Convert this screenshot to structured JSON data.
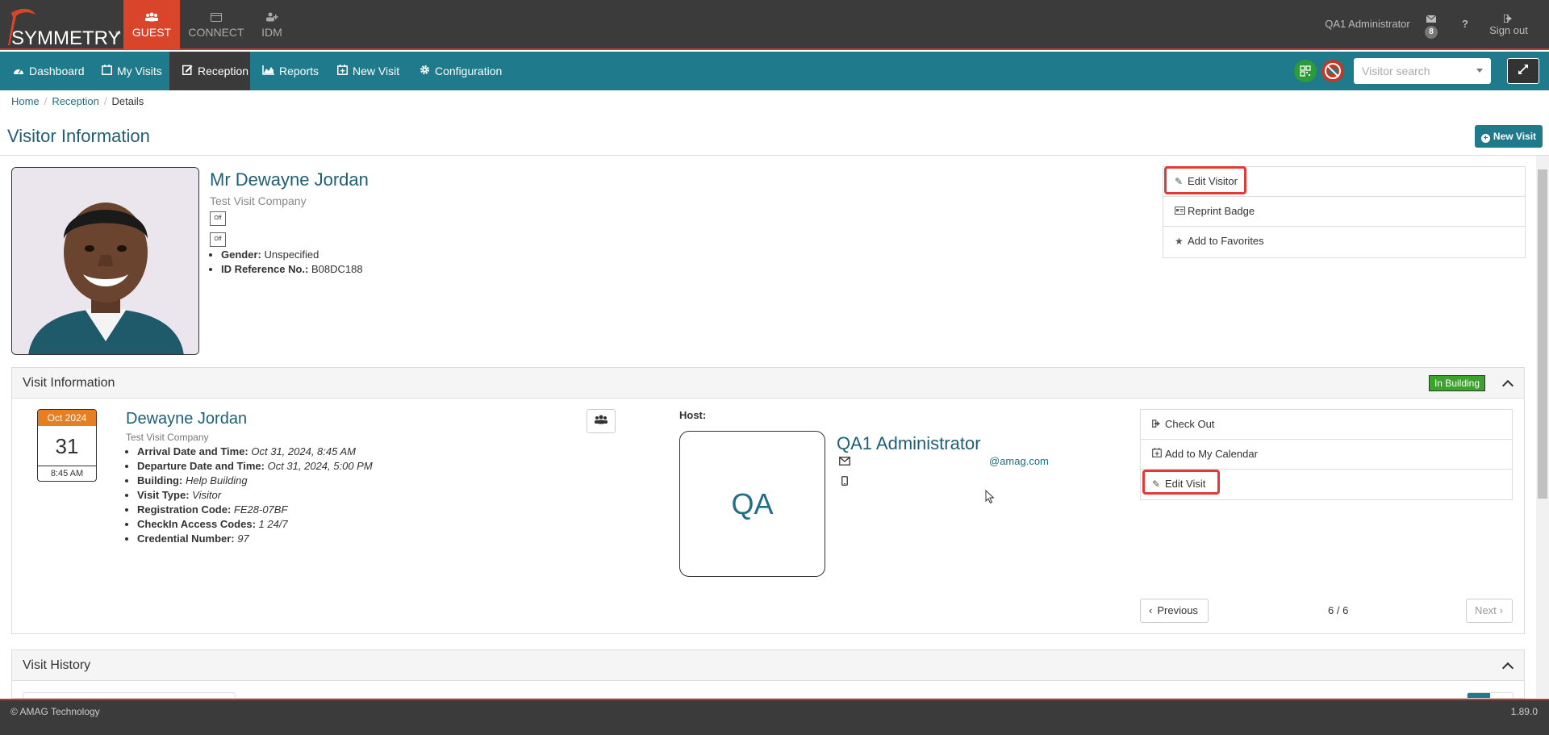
{
  "brand": {
    "logo_text": "SYMMETRY",
    "logo_tm": "™"
  },
  "modules": [
    {
      "label": "GUEST",
      "icon": "users-icon"
    },
    {
      "label": "CONNECT",
      "icon": "card-icon"
    },
    {
      "label": "IDM",
      "icon": "user-plus-icon"
    }
  ],
  "top_right": {
    "user": "QA1 Administrator",
    "mail_count": "8",
    "help": "?",
    "signout": "Sign out"
  },
  "nav": [
    {
      "label": "Dashboard",
      "icon": "dashboard-icon"
    },
    {
      "label": "My Visits",
      "icon": "calendar-icon"
    },
    {
      "label": "Reception",
      "icon": "edit-icon"
    },
    {
      "label": "Reports",
      "icon": "area-chart-icon"
    },
    {
      "label": "New Visit",
      "icon": "calendar-plus-icon"
    },
    {
      "label": "Configuration",
      "icon": "gear-icon"
    }
  ],
  "search": {
    "placeholder": "Visitor search"
  },
  "breadcrumb": [
    "Home",
    "Reception",
    "Details"
  ],
  "page": {
    "title": "Visitor Information",
    "new_visit_label": "New Visit"
  },
  "visitor": {
    "name": "Mr Dewayne Jordan",
    "company": "Test Visit Company",
    "toggle1": "Off",
    "toggle2": "Off",
    "gender_label": "Gender:",
    "gender": "Unspecified",
    "idref_label": "ID Reference No.:",
    "idref": "B08DC188",
    "actions": [
      "Edit Visitor",
      "Reprint Badge",
      "Add to Favorites"
    ]
  },
  "visit_info": {
    "title": "Visit Information",
    "status": "In Building",
    "cal_month": "Oct 2024",
    "cal_day": "31",
    "cal_time": "8:45 AM",
    "name": "Dewayne Jordan",
    "company": "Test Visit Company",
    "details": [
      {
        "label": "Arrival Date and Time:",
        "value": "Oct 31, 2024, 8:45 AM"
      },
      {
        "label": "Departure Date and Time:",
        "value": "Oct 31, 2024, 5:00 PM"
      },
      {
        "label": "Building:",
        "value": "Help Building"
      },
      {
        "label": "Visit Type:",
        "value": "Visitor"
      },
      {
        "label": "Registration Code:",
        "value": "FE28-07BF"
      },
      {
        "label": "CheckIn Access Codes:",
        "value": "1 24/7"
      },
      {
        "label": "Credential Number:",
        "value": "97"
      }
    ],
    "host_label": "Host:",
    "host_initials": "QA",
    "host_name": "QA1 Administrator",
    "host_email": "@amag.com",
    "actions": [
      "Check Out",
      "Add to My Calendar",
      "Edit Visit"
    ],
    "prev_label": "Previous",
    "next_label": "Next",
    "page_count": "6 / 6"
  },
  "visit_history": {
    "title": "Visit History"
  },
  "footer": {
    "copyright": "© AMAG Technology",
    "version": "1.89.0"
  },
  "colors": {
    "teal": "#1f7b8c",
    "guest_active": "#d9452b",
    "status_green": "#3ba32c",
    "calendar_orange": "#e67e22"
  }
}
